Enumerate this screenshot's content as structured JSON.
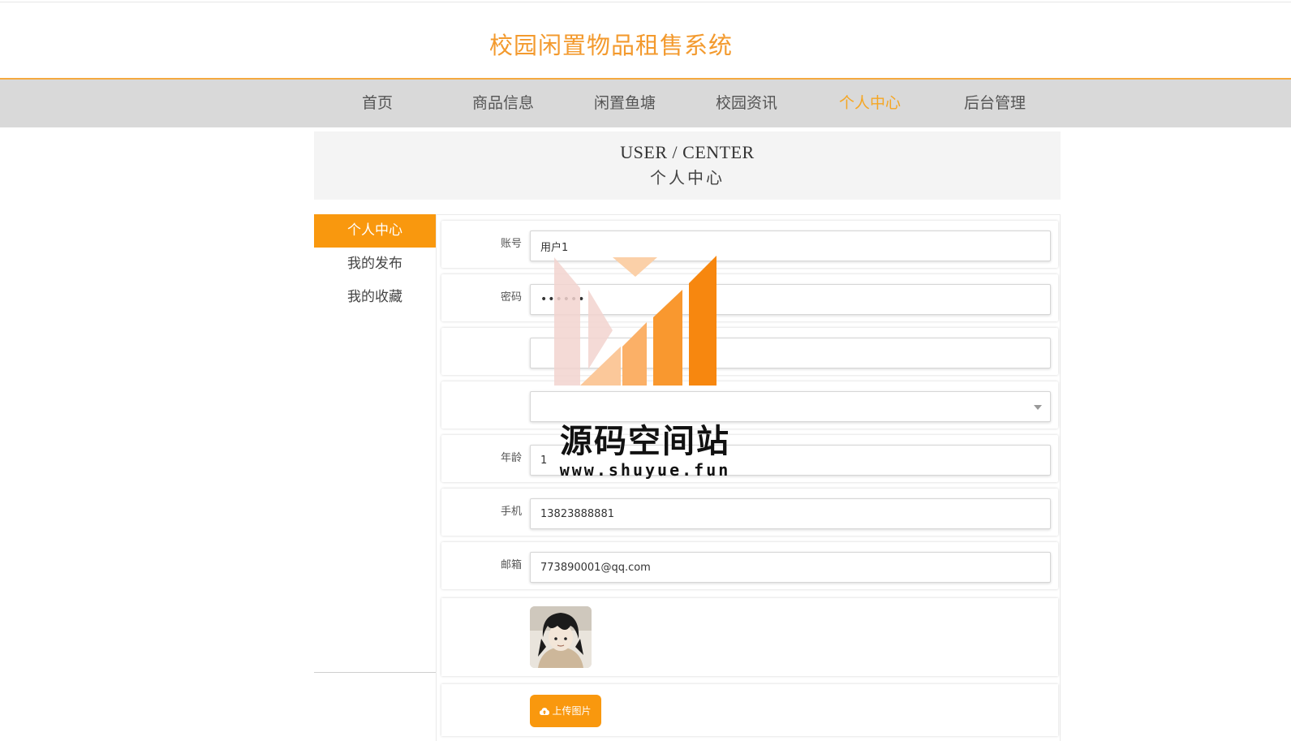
{
  "site": {
    "title": "校园闲置物品租售系统"
  },
  "nav": {
    "items": [
      {
        "label": "首页",
        "active": false
      },
      {
        "label": "商品信息",
        "active": false
      },
      {
        "label": "闲置鱼塘",
        "active": false
      },
      {
        "label": "校园资讯",
        "active": false
      },
      {
        "label": "个人中心",
        "active": true
      },
      {
        "label": "后台管理",
        "active": false
      }
    ]
  },
  "banner": {
    "en": "USER / CENTER",
    "cn": "个人中心"
  },
  "sidebar": {
    "items": [
      {
        "label": "个人中心",
        "active": true
      },
      {
        "label": "我的发布",
        "active": false
      },
      {
        "label": "我的收藏",
        "active": false
      }
    ]
  },
  "form": {
    "account": {
      "label": "账号",
      "value": "用户1"
    },
    "password": {
      "label": "密码",
      "value": "••••••"
    },
    "name": {
      "label": "",
      "value": ""
    },
    "gender": {
      "label": "",
      "value": ""
    },
    "age": {
      "label": "年龄",
      "value": "1"
    },
    "phone": {
      "label": "手机",
      "value": "13823888881"
    },
    "email": {
      "label": "邮箱",
      "value": "773890001@qq.com"
    },
    "upload_label": "上传图片"
  },
  "watermark": {
    "title": "源码空间站",
    "url": "www.shuyue.fun"
  },
  "colors": {
    "accent": "#f9980e",
    "title": "#f39a2e",
    "nav_bg": "#d9d9d9"
  }
}
